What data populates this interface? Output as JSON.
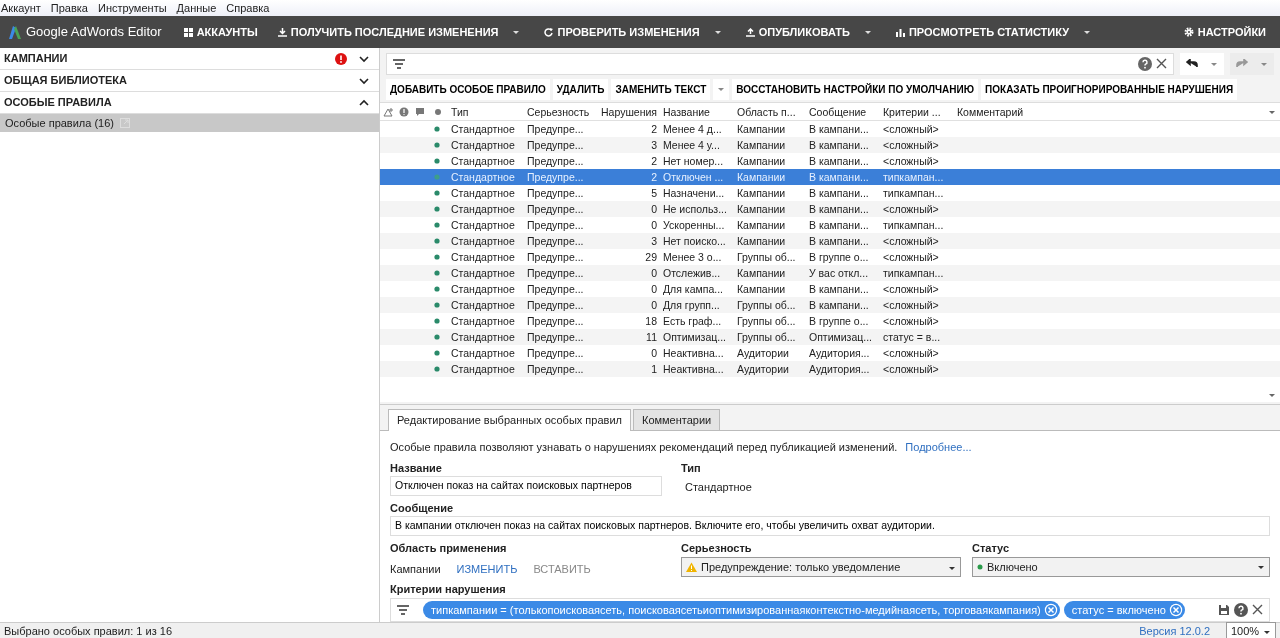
{
  "menu": [
    "Аккаунт",
    "Правка",
    "Инструменты",
    "Данные",
    "Справка"
  ],
  "toolbar": {
    "app_title": "Google AdWords Editor",
    "buttons": [
      {
        "label": "АККАУНТЫ",
        "dropdown": false
      },
      {
        "label": "ПОЛУЧИТЬ ПОСЛЕДНИЕ ИЗМЕНЕНИЯ",
        "dropdown": true
      },
      {
        "label": "ПРОВЕРИТЬ ИЗМЕНЕНИЯ",
        "dropdown": true
      },
      {
        "label": "ОПУБЛИКОВАТЬ",
        "dropdown": true
      },
      {
        "label": "ПРОСМОТРЕТЬ СТАТИСТИКУ",
        "dropdown": true
      }
    ],
    "settings": "НАСТРОЙКИ"
  },
  "sidebar": {
    "sections": [
      {
        "title": "КАМПАНИИ",
        "expanded": false,
        "error": true
      },
      {
        "title": "ОБЩАЯ БИБЛИОТЕКА",
        "expanded": false,
        "error": false
      },
      {
        "title": "ОСОБЫЕ ПРАВИЛА",
        "expanded": true,
        "error": false,
        "items": [
          {
            "label": "Особые правила (16)",
            "selected": true
          }
        ]
      }
    ]
  },
  "actions": [
    {
      "label": "ДОБАВИТЬ ОСОБОЕ ПРАВИЛО",
      "dropdown": false
    },
    {
      "label": "УДАЛИТЬ",
      "dropdown": false
    },
    {
      "label": "ЗАМЕНИТЬ ТЕКСТ",
      "dropdown": true
    },
    {
      "label": "ВОССТАНОВИТЬ НАСТРОЙКИ ПО УМОЛЧАНИЮ",
      "dropdown": false
    },
    {
      "label": "ПОКАЗАТЬ ПРОИГНОРИРОВАННЫЕ НАРУШЕНИЯ",
      "dropdown": false
    }
  ],
  "table": {
    "icon_columns": [
      {
        "kind": "sort"
      },
      {
        "kind": "error"
      },
      {
        "kind": "comment"
      },
      {
        "kind": "status"
      }
    ],
    "columns": [
      {
        "kind": "text",
        "label": "Тип"
      },
      {
        "kind": "text",
        "label": "Серьезность"
      },
      {
        "kind": "number",
        "label": "Нарушения"
      },
      {
        "kind": "text",
        "label": "Название"
      },
      {
        "kind": "text",
        "label": "Область п..."
      },
      {
        "kind": "text",
        "label": "Сообщение"
      },
      {
        "kind": "text",
        "label": "Критерии ..."
      },
      {
        "kind": "text",
        "label": "Комментарий"
      }
    ],
    "rows": [
      {
        "selected": false,
        "cells": [
          "Стандартное",
          "Предупре...",
          "2",
          "Менее 4 д...",
          "Кампании",
          "В кампани...",
          "<сложный>"
        ]
      },
      {
        "selected": false,
        "cells": [
          "Стандартное",
          "Предупре...",
          "3",
          "Менее 4 у...",
          "Кампании",
          "В кампани...",
          "<сложный>"
        ]
      },
      {
        "selected": false,
        "cells": [
          "Стандартное",
          "Предупре...",
          "2",
          "Нет номер...",
          "Кампании",
          "В кампани...",
          "<сложный>"
        ]
      },
      {
        "selected": true,
        "cells": [
          "Стандартное",
          "Предупре...",
          "2",
          "Отключен ...",
          "Кампании",
          "В кампани...",
          "типкампан..."
        ]
      },
      {
        "selected": false,
        "cells": [
          "Стандартное",
          "Предупре...",
          "5",
          "Назначени...",
          "Кампании",
          "В кампани...",
          "типкампан..."
        ]
      },
      {
        "selected": false,
        "cells": [
          "Стандартное",
          "Предупре...",
          "0",
          "Не использ...",
          "Кампании",
          "В кампани...",
          "<сложный>"
        ]
      },
      {
        "selected": false,
        "cells": [
          "Стандартное",
          "Предупре...",
          "0",
          "Ускоренны...",
          "Кампании",
          "В кампани...",
          "типкампан..."
        ]
      },
      {
        "selected": false,
        "cells": [
          "Стандартное",
          "Предупре...",
          "3",
          "Нет поиско...",
          "Кампании",
          "В кампани...",
          "<сложный>"
        ]
      },
      {
        "selected": false,
        "cells": [
          "Стандартное",
          "Предупре...",
          "29",
          "Менее 3 о...",
          "Группы об...",
          "В группе о...",
          "<сложный>"
        ]
      },
      {
        "selected": false,
        "cells": [
          "Стандартное",
          "Предупре...",
          "0",
          "Отслежив...",
          "Кампании",
          "У вас откл...",
          "типкампан..."
        ]
      },
      {
        "selected": false,
        "cells": [
          "Стандартное",
          "Предупре...",
          "0",
          "Для кампа...",
          "Кампании",
          "В кампани...",
          "<сложный>"
        ]
      },
      {
        "selected": false,
        "cells": [
          "Стандартное",
          "Предупре...",
          "0",
          "Для групп...",
          "Группы об...",
          "В кампани...",
          "<сложный>"
        ]
      },
      {
        "selected": false,
        "cells": [
          "Стандартное",
          "Предупре...",
          "18",
          "Есть граф...",
          "Группы об...",
          "В группе о...",
          "<сложный>"
        ]
      },
      {
        "selected": false,
        "cells": [
          "Стандартное",
          "Предупре...",
          "11",
          "Оптимизац...",
          "Группы об...",
          "Оптимизац...",
          "статус = в..."
        ]
      },
      {
        "selected": false,
        "cells": [
          "Стандартное",
          "Предупре...",
          "0",
          "Неактивна...",
          "Аудитории",
          "Аудитория...",
          "<сложный>"
        ]
      },
      {
        "selected": false,
        "cells": [
          "Стандартное",
          "Предупре...",
          "1",
          "Неактивна...",
          "Аудитории",
          "Аудитория...",
          "<сложный>"
        ]
      }
    ]
  },
  "editor": {
    "tabs": [
      {
        "label": "Редактирование выбранных особых правил",
        "selected": true
      },
      {
        "label": "Комментарии",
        "selected": false
      }
    ],
    "intro": "Особые правила позволяют узнавать о нарушениях рекомендаций перед публикацией изменений.",
    "more_link": "Подробнее...",
    "name_label": "Название",
    "name_value": "Отключен показ на сайтах поисковых партнеров",
    "type_label": "Тип",
    "type_value": "Стандартное",
    "message_label": "Сообщение",
    "message_value": "В кампании отключен показ на сайтах поисковых партнеров. Включите его, чтобы увеличить охват аудитории.",
    "scope_label": "Область применения",
    "scope_value": "Кампании",
    "scope_change": "ИЗМЕНИТЬ",
    "scope_paste": "ВСТАВИТЬ",
    "severity_label": "Серьезность",
    "severity_value": "Предупреждение: только уведомление",
    "status_label": "Статус",
    "status_value": "Включено",
    "criteria_label": "Критерии нарушения",
    "criteria": [
      "типкампании = (толькопоисковаясеть, поисковаясетьиоптимизированнаяконтекстно-медийнаясеть, торговаякампания)",
      "статус = включено"
    ]
  },
  "status_bar": {
    "text": "Выбрано особых правил: 1 из 16",
    "version": "Версия 12.0.2",
    "zoom": "100%"
  }
}
